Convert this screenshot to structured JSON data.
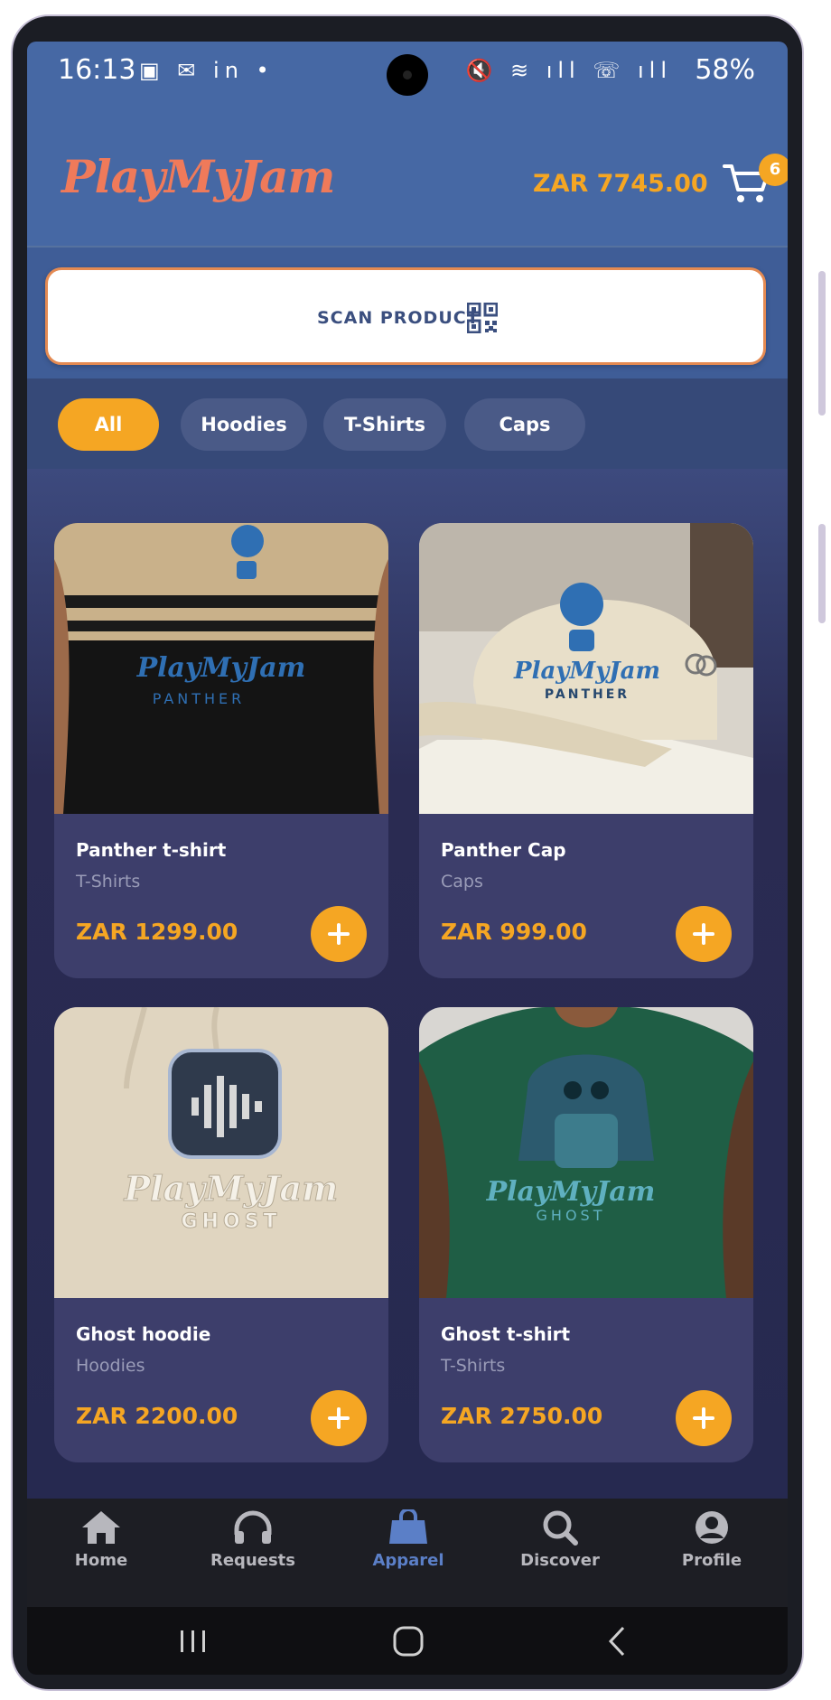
{
  "status_bar": {
    "time": "16:13",
    "left_icons": "▣ ✉ in •",
    "right_icons": "🔇 ≋ ıll ☏ ıll",
    "battery": "58%"
  },
  "header": {
    "logo": "PlayMyJam",
    "cart_total": "ZAR 7745.00",
    "cart_count": "6"
  },
  "scan": {
    "label": "SCAN PRODUCT"
  },
  "tabs": [
    {
      "label": "All",
      "active": true
    },
    {
      "label": "Hoodies",
      "active": false
    },
    {
      "label": "T-Shirts",
      "active": false
    },
    {
      "label": "Caps",
      "active": false
    }
  ],
  "products": [
    {
      "name": "Panther t-shirt",
      "category": "T-Shirts",
      "price": "ZAR 1299.00",
      "image_text": "PlayMyJam",
      "image_sub": "PANTHER",
      "image_colors": [
        "#c9b18a",
        "#1a1a1a"
      ]
    },
    {
      "name": "Panther Cap",
      "category": "Caps",
      "price": "ZAR 999.00",
      "image_text": "PlayMyJam",
      "image_sub": "PANTHER",
      "image_colors": [
        "#e8dfc9",
        "#f2efe6"
      ]
    },
    {
      "name": "Ghost hoodie",
      "category": "Hoodies",
      "price": "ZAR 2200.00",
      "image_text": "PlayMyJam",
      "image_sub": "GHOST",
      "image_colors": [
        "#e6dccb",
        "#d9cdb6"
      ]
    },
    {
      "name": "Ghost t-shirt",
      "category": "T-Shirts",
      "price": "ZAR 2750.00",
      "image_text": "PlayMyJam",
      "image_sub": "GHOST",
      "image_colors": [
        "#1f5e45",
        "#d8d6d2"
      ]
    }
  ],
  "bottom_nav": [
    {
      "label": "Home",
      "icon": "home-icon"
    },
    {
      "label": "Requests",
      "icon": "headphones-icon"
    },
    {
      "label": "Apparel",
      "icon": "shopping-bag-icon",
      "active": true
    },
    {
      "label": "Discover",
      "icon": "search-icon"
    },
    {
      "label": "Profile",
      "icon": "profile-icon"
    }
  ],
  "colors": {
    "accent": "#f5a623",
    "header_bg": "#4668a4",
    "nav_active": "#5b7fc7"
  }
}
